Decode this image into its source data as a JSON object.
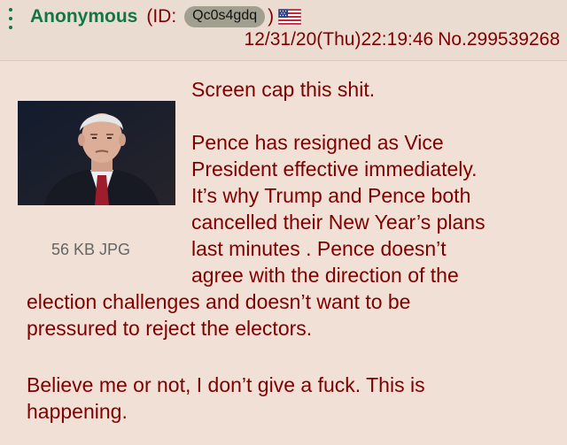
{
  "header": {
    "poster_name": "Anonymous",
    "id_prefix": "(ID:",
    "poster_id": "Qc0s4gdq",
    "id_suffix": ")",
    "flag_icon": "us-flag-icon",
    "timestamp": "12/31/20(Thu)22:19:46",
    "post_number": "No.299539268"
  },
  "file": {
    "info": "56 KB JPG"
  },
  "post": {
    "lines": [
      "Screen cap this shit.",
      "Pence has resigned as Vice",
      "President effective immediately.",
      "It’s why Trump and Pence both",
      "cancelled their New Year’s plans",
      "last minutes . Pence doesn’t",
      "agree with the direction of the",
      "election challenges and doesn’t want to be",
      "pressured to reject the electors.",
      "Believe me or not, I don’t give a fuck. This is",
      "happening."
    ]
  },
  "colors": {
    "background": "#f0e0d6",
    "header_background": "#ebdcd2",
    "name": "#117743",
    "text": "#800000",
    "id_badge": "#a19f8f"
  }
}
